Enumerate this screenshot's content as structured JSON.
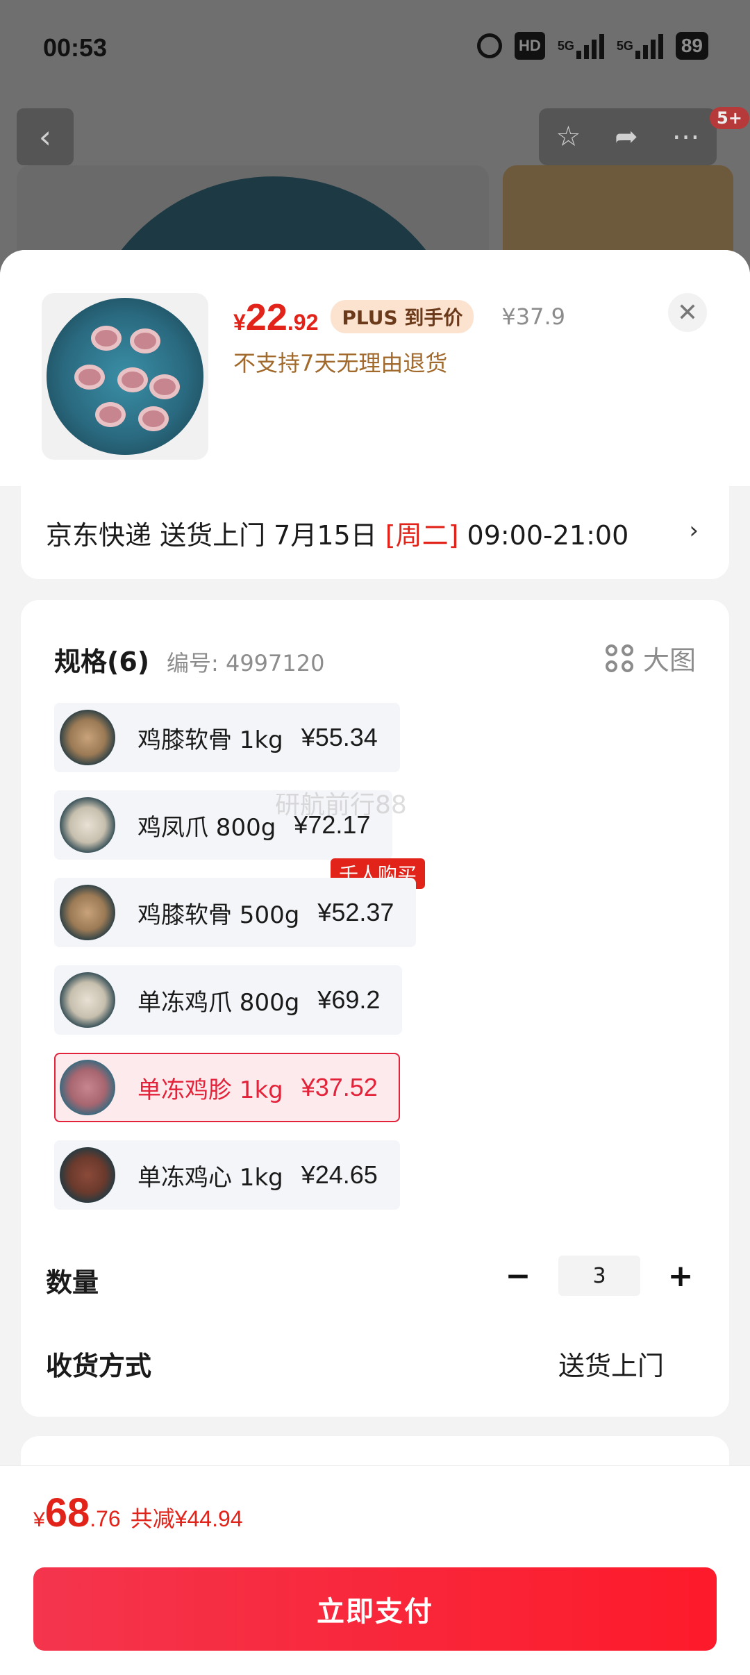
{
  "status_bar": {
    "time": "00:53",
    "hd": "HD",
    "net1": "5G",
    "net2": "5G",
    "battery": "89"
  },
  "background": {
    "back_icon": "chevron-left-icon",
    "actions": [
      "star-icon",
      "share-icon",
      "more-icon"
    ],
    "badge": "5+"
  },
  "sku": {
    "price_symbol": "¥",
    "price_int": "22",
    "price_dec": ".92",
    "plus_tag": "PLUS 到手价",
    "original_price": "¥37.9",
    "return_policy": "不支持7天无理由退货"
  },
  "delivery": {
    "text": "京东快递 送货上门 7月15日 ",
    "weekday": "[周二]",
    "window": " 09:00-21:00"
  },
  "spec": {
    "title": "规格(6)",
    "code": "编号: 4997120",
    "big_image_label": "大图",
    "options": [
      {
        "name": "鸡膝软骨 1kg",
        "price": "¥55.34",
        "selected": false
      },
      {
        "name": "鸡凤爪 800g",
        "price": "¥72.17",
        "selected": false
      },
      {
        "name": "鸡膝软骨 500g",
        "price": "¥52.37",
        "selected": false,
        "tag": "千人购买"
      },
      {
        "name": "单冻鸡爪 800g",
        "price": "¥69.2",
        "selected": false
      },
      {
        "name": "单冻鸡胗 1kg",
        "price": "¥37.52",
        "selected": true
      },
      {
        "name": "单冻鸡心 1kg",
        "price": "¥24.65",
        "selected": false
      }
    ]
  },
  "quantity": {
    "label": "数量",
    "minus": "−",
    "value": "3",
    "plus": "+"
  },
  "receive": {
    "label": "收货方式",
    "value": "送货上门"
  },
  "watermark": "研航前行88",
  "footer": {
    "total_symbol": "¥",
    "total_int": "68",
    "total_dec": ".76",
    "saving": "共减¥44.94",
    "pay_label": "立即支付"
  },
  "colors": {
    "accent": "#e2231a",
    "selected_bg": "#fdeaec",
    "gold": "#a16a2c"
  }
}
